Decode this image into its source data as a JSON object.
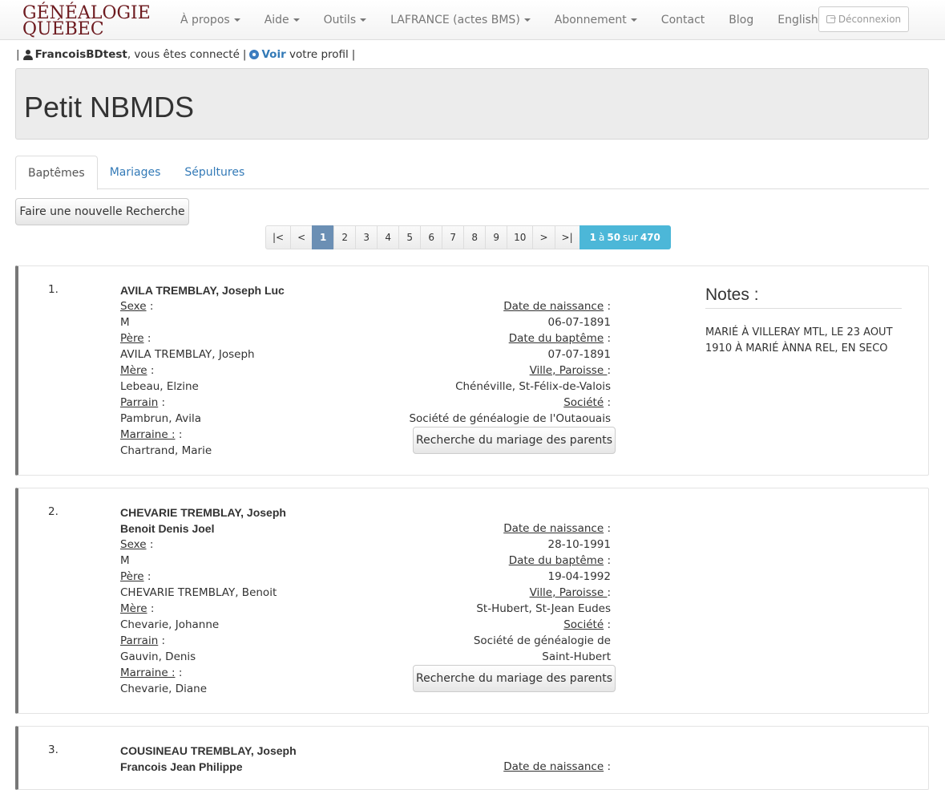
{
  "logo": {
    "line1": "GÉNÉALOGIE",
    "line2": "QUÉBEC"
  },
  "nav": {
    "items": [
      {
        "label": "À propos",
        "dropdown": true
      },
      {
        "label": "Aide",
        "dropdown": true
      },
      {
        "label": "Outils",
        "dropdown": true
      },
      {
        "label": "LAFRANCE (actes BMS)",
        "dropdown": true
      },
      {
        "label": "Abonnement",
        "dropdown": true
      },
      {
        "label": "Contact",
        "dropdown": false
      },
      {
        "label": "Blog",
        "dropdown": false
      },
      {
        "label": "English",
        "dropdown": false
      }
    ],
    "logout_label": "Déconnexion"
  },
  "userline": {
    "sep": "|",
    "username": "FrancoisBDtest",
    "connected_text": ", vous êtes connecté",
    "view_label": "Voir",
    "profile_text": "votre profil"
  },
  "page_title": "Petit NBMDS",
  "tabs": [
    {
      "label": "Baptêmes",
      "active": true
    },
    {
      "label": "Mariages",
      "active": false
    },
    {
      "label": "Sépultures",
      "active": false
    }
  ],
  "new_search_label": "Faire une nouvelle Recherche",
  "pagination": {
    "first": "|<",
    "prev": "<",
    "next": ">",
    "last": ">|",
    "pages": [
      "1",
      "2",
      "3",
      "4",
      "5",
      "6",
      "7",
      "8",
      "9",
      "10"
    ],
    "current_page": "1",
    "info_from": "1",
    "info_to_word": "à",
    "info_to": "50",
    "info_of_word": "sur",
    "info_total": "470"
  },
  "labels": {
    "sexe": "Sexe",
    "pere": "Père",
    "mere": "Mère",
    "parrain": "Parrain",
    "marraine": "Marraine :",
    "date_naissance": "Date de naissance",
    "date_bapteme": "Date du baptême",
    "ville_paroisse": "Ville, Paroisse ",
    "societe": "Société",
    "colon": ":",
    "search_parents": "Recherche du mariage des parents",
    "notes_title": "Notes :"
  },
  "records": [
    {
      "num": "1.",
      "name": "AVILA TREMBLAY, Joseph Luc",
      "sexe": "M",
      "pere": "AVILA TREMBLAY, Joseph",
      "mere": "Lebeau, Elzine",
      "parrain": "Pambrun, Avila",
      "marraine": "Chartrand, Marie",
      "date_naissance": "06-07-1891",
      "date_bapteme": "07-07-1891",
      "ville_paroisse": "Chénéville, St-Félix-de-Valois",
      "societe": "Société de généalogie de l'Outaouais",
      "notes": "MARIÉ À VILLERAY MTL, LE 23 AOUT 1910 À MARIÉ ÀNNA REL, EN SECO"
    },
    {
      "num": "2.",
      "name": "CHEVARIE TREMBLAY, Joseph Benoit Denis Joel",
      "sexe": "M",
      "pere": "CHEVARIE TREMBLAY, Benoit",
      "mere": "Chevarie, Johanne",
      "parrain": "Gauvin, Denis",
      "marraine": "Chevarie, Diane",
      "date_naissance": "28-10-1991",
      "date_bapteme": "19-04-1992",
      "ville_paroisse": "St-Hubert, St-Jean Eudes",
      "societe": "Société de généalogie de Saint-Hubert"
    },
    {
      "num": "3.",
      "name": "COUSINEAU TREMBLAY, Joseph Francois Jean Philippe"
    }
  ]
}
